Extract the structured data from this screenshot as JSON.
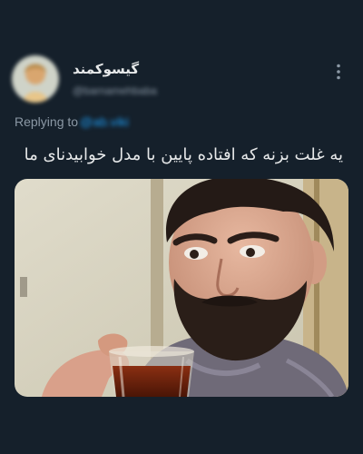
{
  "tweet": {
    "display_name": "گیسوکمند",
    "handle": "@barnamehbaba",
    "replying_label": "Replying to",
    "reply_target": "@ab.viki",
    "text": "یه غلت بزنه که افتاده پایین با مدل خوابیدنای ما",
    "more_icon": "more-vertical-icon",
    "media_alt": "photo-of-bearded-man-holding-tea-glass"
  },
  "colors": {
    "background": "#15202b",
    "primary_text": "#e7e9ea",
    "secondary_text": "#8b98a5",
    "link": "#1d9bf0"
  }
}
